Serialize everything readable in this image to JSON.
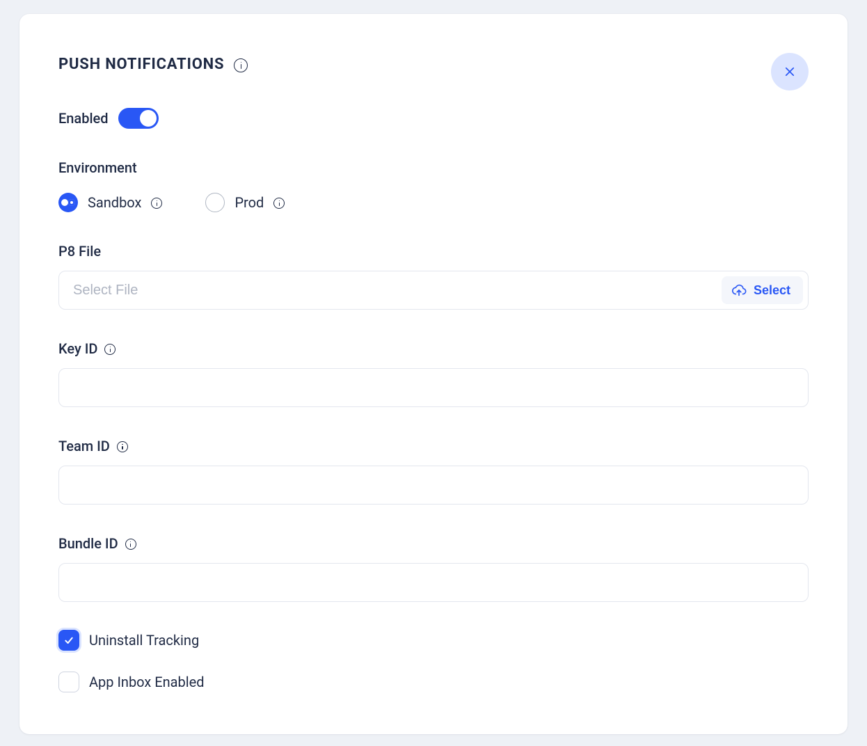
{
  "title": "PUSH NOTIFICATIONS",
  "enabled": {
    "label": "Enabled",
    "value": true
  },
  "environment": {
    "label": "Environment",
    "options": [
      {
        "label": "Sandbox",
        "selected": true
      },
      {
        "label": "Prod",
        "selected": false
      }
    ]
  },
  "p8file": {
    "label": "P8 File",
    "placeholder": "Select File",
    "value": "",
    "button": "Select"
  },
  "keyid": {
    "label": "Key ID",
    "value": ""
  },
  "teamid": {
    "label": "Team ID",
    "value": ""
  },
  "bundleid": {
    "label": "Bundle ID",
    "value": ""
  },
  "uninstall": {
    "label": "Uninstall Tracking",
    "checked": true
  },
  "appinbox": {
    "label": "App Inbox Enabled",
    "checked": false
  }
}
